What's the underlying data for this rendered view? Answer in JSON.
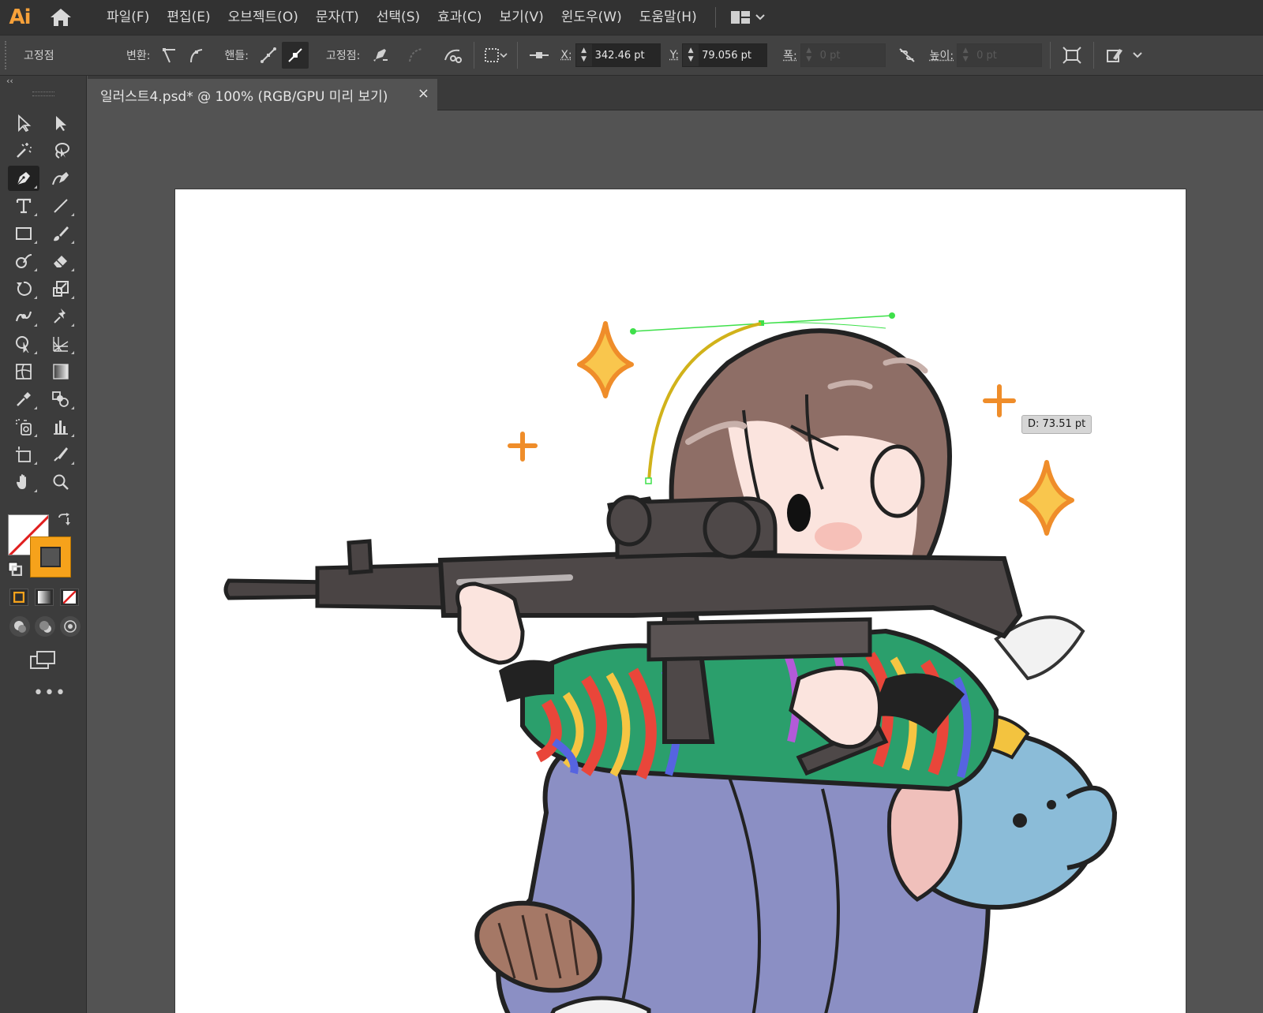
{
  "app": {
    "logo": "Ai",
    "brand_color": "#f7a13a"
  },
  "menu": [
    "파일(F)",
    "편집(E)",
    "오브젝트(O)",
    "문자(T)",
    "선택(S)",
    "효과(C)",
    "보기(V)",
    "윈도우(W)",
    "도움말(H)"
  ],
  "control": {
    "selection_type": "고정점",
    "convert_label": "변환:",
    "handles_label": "핸들:",
    "anchor_label": "고정점:",
    "x_label": "X:",
    "x_value": "342.46 pt",
    "y_label": "Y:",
    "y_value": "79.056 pt",
    "w_label": "폭:",
    "w_value": "0 pt",
    "h_label": "높이:",
    "h_value": "0 pt"
  },
  "document": {
    "tab_title": "일러스트4.psd* @ 100% (RGB/GPU 미리 보기)",
    "close_glyph": "×"
  },
  "canvas": {
    "distance_tooltip": "D: 73.51 pt"
  },
  "toolbar": {
    "more_glyph": "•••",
    "stroke_color": "#f6a21b",
    "fill": "none"
  }
}
